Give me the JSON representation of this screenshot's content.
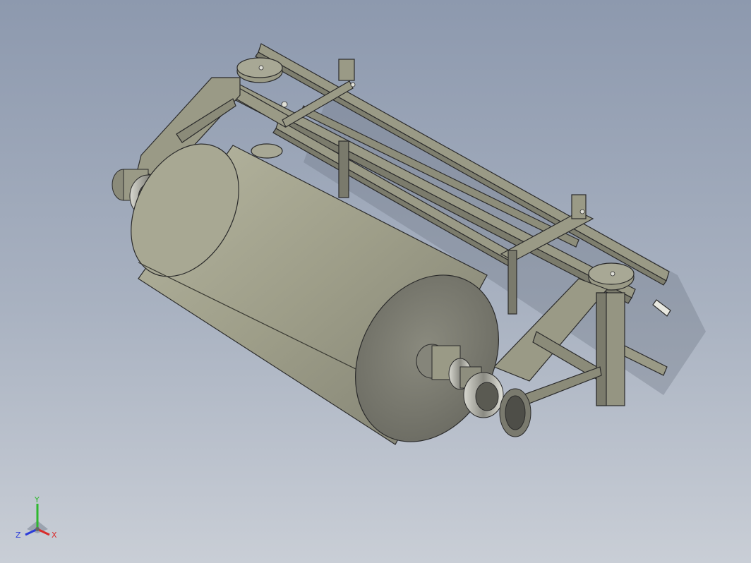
{
  "viewport": {
    "background_top": "#8d99ae",
    "background_bottom": "#c9ced6",
    "model": {
      "body_color": "#9a9a86",
      "roller_color": "#a3a38d",
      "roller_end_color": "#85857a",
      "shadow_color": "#6e7585",
      "edge_color": "#2b2b2b"
    }
  },
  "triad": {
    "y_label": "Y",
    "x_label": "X",
    "z_label": "Z",
    "y_color": "#2eb82e",
    "x_color": "#d92b2b",
    "z_color": "#2b3bd9"
  }
}
